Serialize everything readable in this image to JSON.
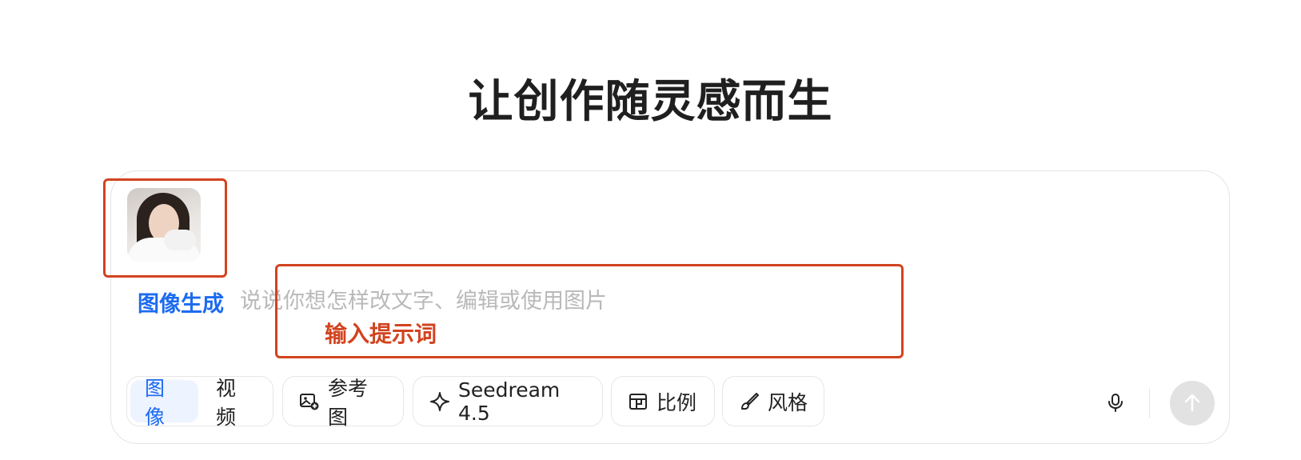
{
  "header": {
    "title": "让创作随灵感而生"
  },
  "composer": {
    "mode_label": "图像生成",
    "prompt_placeholder": "说说你想怎样改文字、编辑或使用图片",
    "prompt_value": "",
    "reference_image": {
      "icon": "portrait-thumbnail"
    }
  },
  "annotations": {
    "input_label": "输入提示词",
    "color": "#d2431f"
  },
  "toolbar": {
    "mode_tabs": [
      {
        "label": "图像",
        "active": true
      },
      {
        "label": "视频",
        "active": false
      }
    ],
    "reference_label": "参考图",
    "model_label": "Seedream 4.5",
    "ratio_label": "比例",
    "style_label": "风格"
  },
  "colors": {
    "accent": "#1c6bf0",
    "annotation": "#d2431f",
    "send_disabled": "#e2e2e2"
  }
}
